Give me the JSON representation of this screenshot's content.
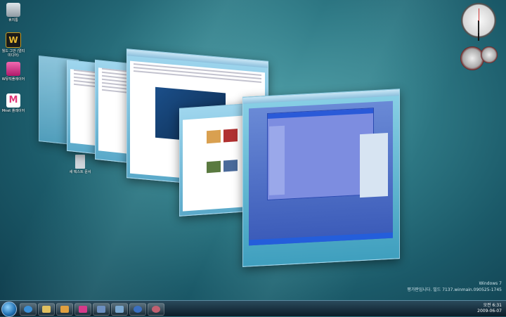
{
  "desktop": {
    "icons": [
      {
        "label": "휴지통",
        "color": "#b0b8c0"
      },
      {
        "label": "월드 그만 (멀티미디어)",
        "color": "#c89a20"
      },
      {
        "label": "W뮤직플레이어",
        "color": "#d63a8a"
      },
      {
        "label": "Mnet 플레이어",
        "color": "#e23a7a"
      },
      {
        "label": "새 텍스트 문서",
        "color": "#c9d0d6"
      }
    ]
  },
  "watermark": {
    "line1": "Windows 7",
    "line2": "평가판입니다. 빌드 7137.winmain.090525-1745"
  },
  "tray": {
    "time": "오전 6:31",
    "date": "2009-06-07"
  },
  "taskbar": {
    "buttons": [
      {
        "name": "internet-explorer-icon",
        "color": "#3a8fd6"
      },
      {
        "name": "explorer-folder-icon",
        "color": "#e0c060"
      },
      {
        "name": "media-player-icon",
        "color": "#e0a040"
      },
      {
        "name": "mnet-player-icon",
        "color": "#d63a8a"
      },
      {
        "name": "virtual-pc-icon",
        "color": "#6c8fc0"
      },
      {
        "name": "network-icon",
        "color": "#7aa8d0"
      },
      {
        "name": "help-icon",
        "color": "#3a6fc0"
      },
      {
        "name": "snipping-tool-icon",
        "color": "#c06070"
      }
    ]
  },
  "colors": {
    "accent": "#1f6fb0",
    "taskbar": "#0c1d28"
  }
}
